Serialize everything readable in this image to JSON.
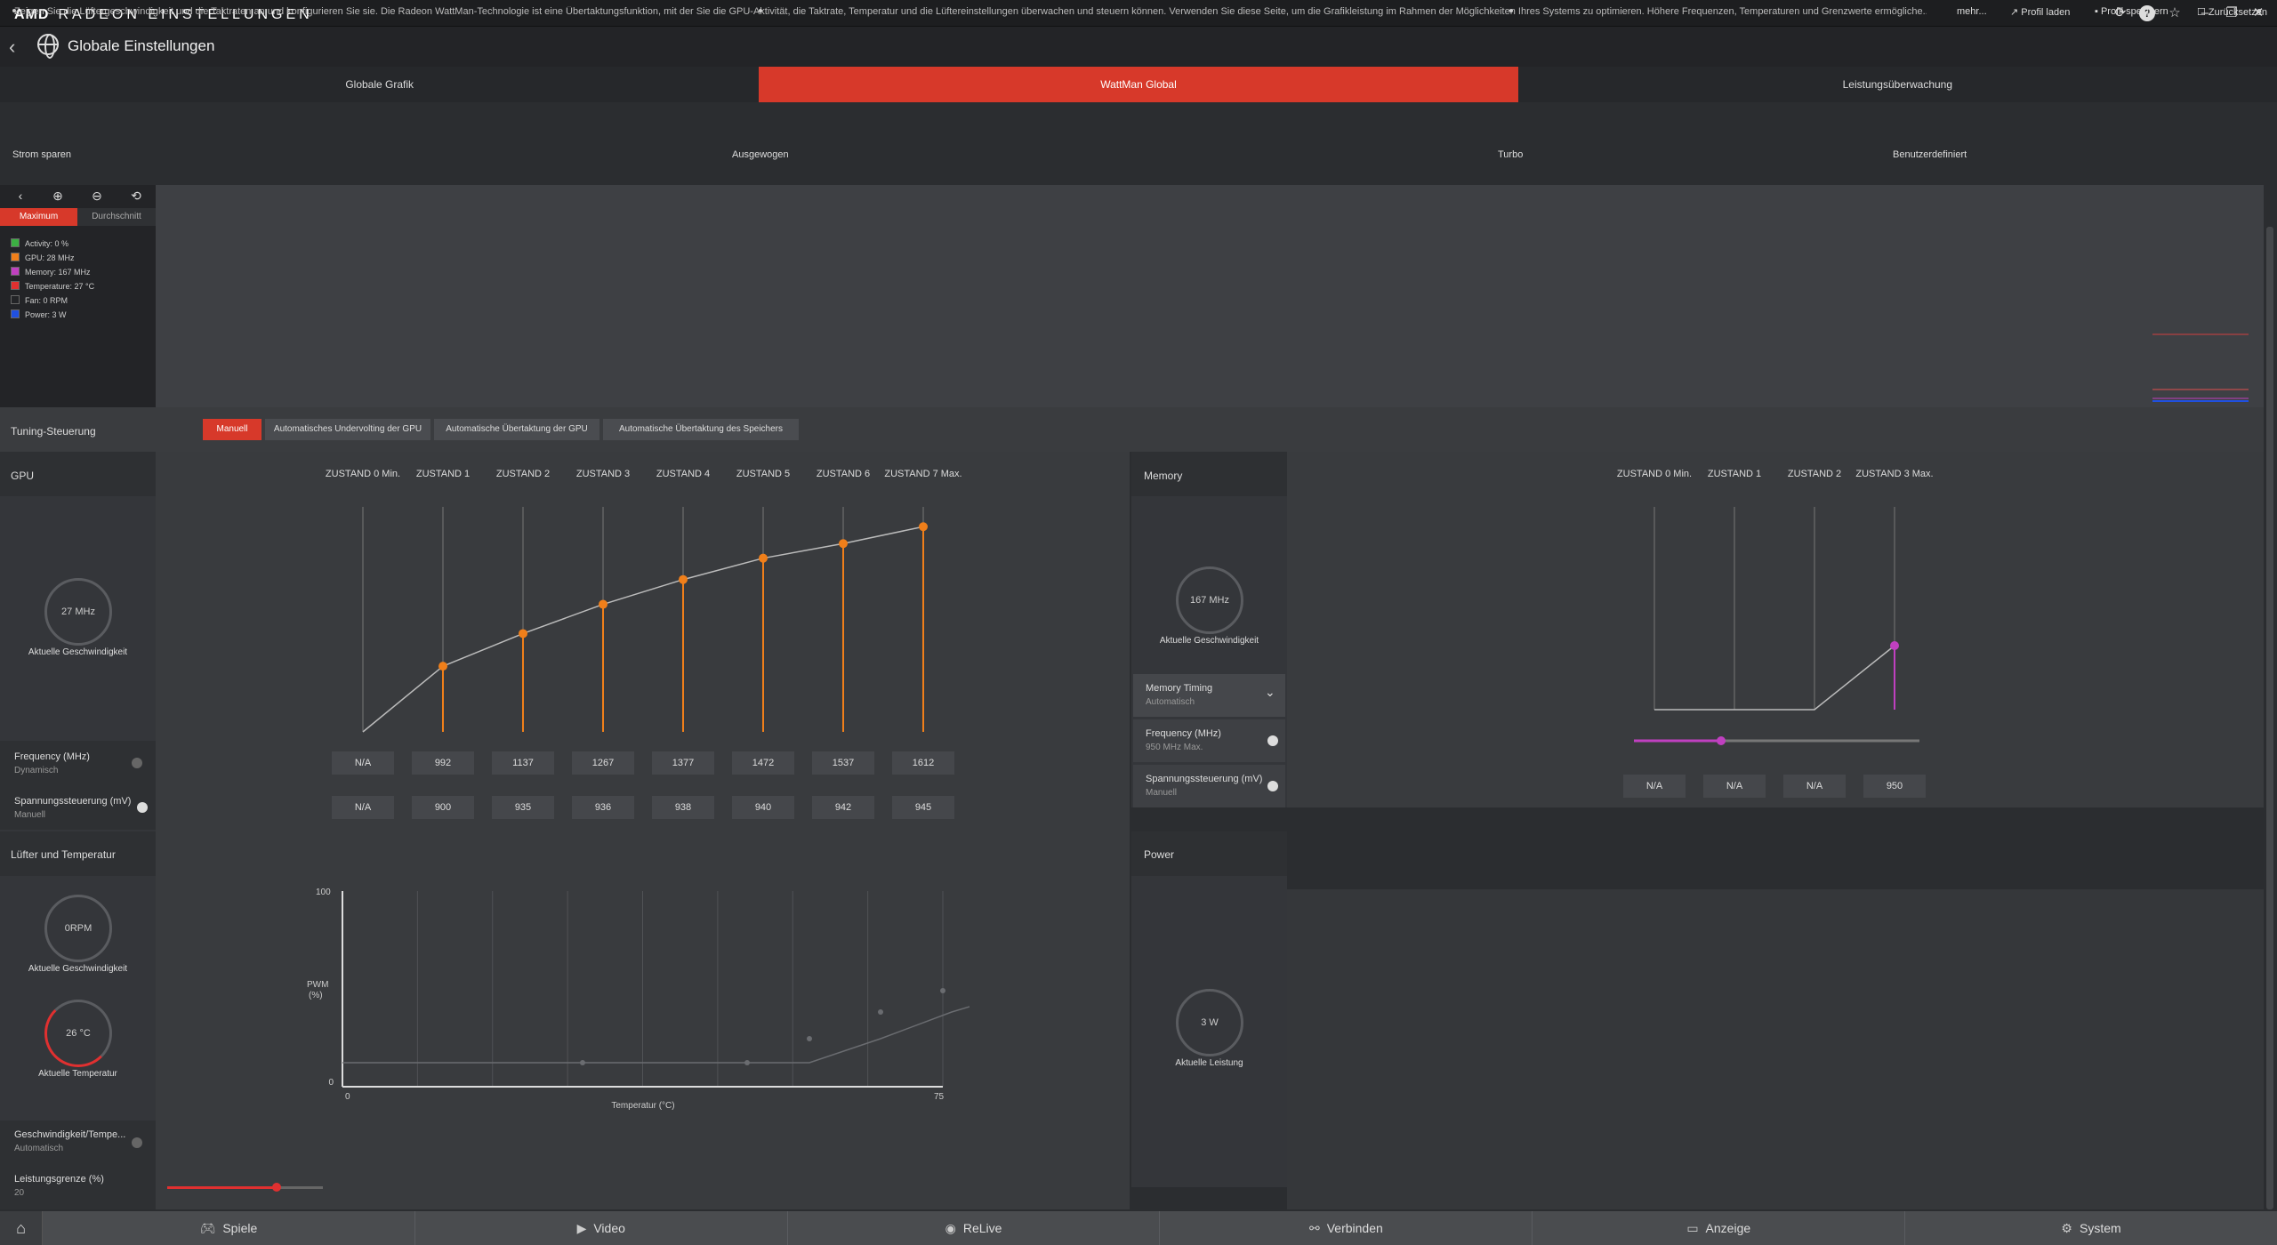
{
  "app": {
    "brand_logo": "AMD",
    "title": "RADEON EINSTELLUNGEN"
  },
  "window": {
    "icons": [
      "update-icon",
      "help-icon",
      "star-icon",
      "minimize-icon",
      "restore-icon",
      "close-icon"
    ]
  },
  "header": {
    "page_title": "Globale Einstellungen"
  },
  "tabs": [
    {
      "label": "Globale Grafik",
      "active": false
    },
    {
      "label": "WattMan Global",
      "active": true
    },
    {
      "label": "Leistungsüberwachung",
      "active": false
    }
  ],
  "info": {
    "text": "Zeigen Sie die Lüftergeschwindigkeit und die Taktraten an und konfigurieren Sie sie. Die Radeon WattMan-Technologie ist eine Übertaktungsfunktion, mit der Sie die GPU-Aktivität, die Taktrate, Temperatur und die Lüftereinstellungen überwachen und steuern können. Verwenden Sie diese Seite, um die Grafikleistung im Rahmen der Möglichkeiten Ihres Systems zu optimieren. Höhere Frequenzen, Temperaturen und Grenzwerte ermögliche...",
    "more": "mehr...",
    "load_profile": "Profil laden",
    "save_profile": "Profil speichern",
    "reset": "Zurücksetzen"
  },
  "presets": [
    "Strom sparen",
    "Ausgewogen",
    "Turbo",
    "Benutzerdefiniert"
  ],
  "graph": {
    "tabs": {
      "max": "Maximum",
      "avg": "Durchschnitt"
    },
    "legend": [
      {
        "label": "Activity: 0 %",
        "color": "#3cb043",
        "checked": true
      },
      {
        "label": "GPU: 28 MHz",
        "color": "#f07f1a",
        "checked": true
      },
      {
        "label": "Memory: 167 MHz",
        "color": "#c040c0",
        "checked": true
      },
      {
        "label": "Temperature: 27 °C",
        "color": "#e03030",
        "checked": true
      },
      {
        "label": "Fan: 0 RPM",
        "color": "#888888",
        "checked": false
      },
      {
        "label": "Power: 3 W",
        "color": "#2050e0",
        "checked": true
      }
    ]
  },
  "tuning": {
    "label": "Tuning-Steuerung",
    "buttons": [
      "Manuell",
      "Automatisches Undervolting der GPU",
      "Automatische Übertaktung der GPU",
      "Automatische Übertaktung des Speichers"
    ]
  },
  "gpu": {
    "title": "GPU",
    "speed": "27 MHz",
    "speed_label": "Aktuelle Geschwindigkeit",
    "states": [
      "ZUSTAND 0 Min.",
      "ZUSTAND 1",
      "ZUSTAND 2",
      "ZUSTAND 3",
      "ZUSTAND 4",
      "ZUSTAND 5",
      "ZUSTAND 6",
      "ZUSTAND 7 Max."
    ],
    "freq_label": "Frequency (MHz)",
    "freq_sub": "Dynamisch",
    "volt_label": "Spannungssteuerung (mV)",
    "volt_sub": "Manuell",
    "freqs": [
      "N/A",
      "992",
      "1137",
      "1267",
      "1377",
      "1472",
      "1537",
      "1612"
    ],
    "volts": [
      "N/A",
      "900",
      "935",
      "936",
      "938",
      "940",
      "942",
      "945"
    ]
  },
  "memory": {
    "title": "Memory",
    "speed": "167 MHz",
    "speed_label": "Aktuelle Geschwindigkeit",
    "timing_label": "Memory Timing",
    "timing_sub": "Automatisch",
    "freq_label": "Frequency (MHz)",
    "freq_sub": "950 MHz Max.",
    "volt_label": "Spannungssteuerung (mV)",
    "volt_sub": "Manuell",
    "states": [
      "ZUSTAND 0 Min.",
      "ZUSTAND 1",
      "ZUSTAND 2",
      "ZUSTAND 3 Max."
    ],
    "volts": [
      "N/A",
      "N/A",
      "N/A",
      "950"
    ]
  },
  "fan": {
    "title": "Lüfter und Temperatur",
    "rpm": "0RPM",
    "rpm_label": "Aktuelle Geschwindigkeit",
    "temp": "26 °C",
    "temp_label": "Aktuelle Temperatur",
    "curve_label": "Geschwindigkeit/Tempe...",
    "curve_sub": "Automatisch",
    "power_label": "Leistungsgrenze (%)",
    "power_value": "20",
    "power_fraction": 0.7,
    "chart": {
      "ylabel": "PWM\n(%)",
      "xlabel": "Temperatur (°C)",
      "ymax": "100",
      "ymin": "0",
      "xmin": "0",
      "xmax": "75"
    }
  },
  "power": {
    "title": "Power",
    "value": "3 W",
    "label": "Aktuelle Leistung"
  },
  "nav": [
    {
      "label": "Spiele",
      "icon": "gamepad-icon"
    },
    {
      "label": "Video",
      "icon": "play-icon"
    },
    {
      "label": "ReLive",
      "icon": "relive-icon"
    },
    {
      "label": "Verbinden",
      "icon": "share-icon"
    },
    {
      "label": "Anzeige",
      "icon": "monitor-icon"
    },
    {
      "label": "System",
      "icon": "gear-icon"
    }
  ]
}
